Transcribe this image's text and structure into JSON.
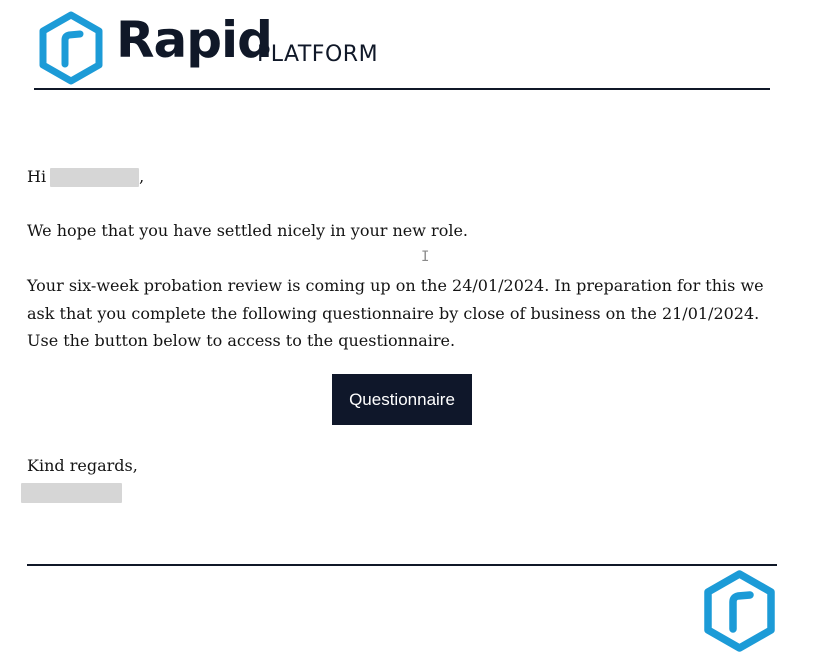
{
  "header": {
    "brand_name": "Rapid",
    "brand_suffix": "PLATFORM",
    "logo_icon": "rapid-hexagon-logo",
    "brand_color": "#1c9bd7"
  },
  "email": {
    "greeting_prefix": "Hi",
    "greeting_suffix": ",",
    "intro": "We hope that you have settled nicely in your new role.",
    "body": "Your six-week probation review is coming up on the 24/01/2024. In preparation for this we ask that you complete the following questionnaire by close of business on the 21/01/2024. Use the button below to access to the questionnaire.",
    "button_label": "Questionnaire",
    "button_color": "#0f172a",
    "closing": "Kind regards,"
  },
  "footer": {
    "logo_icon": "rapid-hexagon-logo"
  }
}
